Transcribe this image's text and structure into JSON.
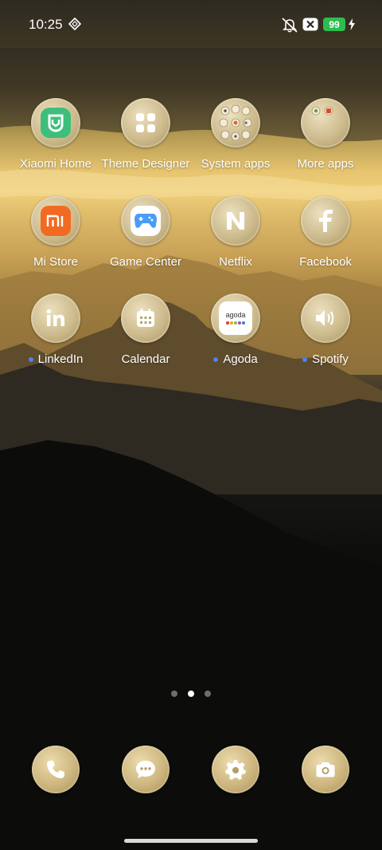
{
  "status_bar": {
    "time": "10:25",
    "battery_level": "99",
    "icons": [
      "vpn-diamond-icon",
      "mute-notifications-icon",
      "close-box-icon",
      "battery-icon",
      "charging-bolt-icon"
    ]
  },
  "apps": [
    {
      "label": "Xiaomi Home",
      "icon": "xiaomi-home-icon",
      "new_dot": false
    },
    {
      "label": "Theme Designer",
      "icon": "theme-designer-icon",
      "new_dot": false
    },
    {
      "label": "System apps",
      "icon": "system-apps-folder-icon",
      "new_dot": false
    },
    {
      "label": "More apps",
      "icon": "more-apps-folder-icon",
      "new_dot": false
    },
    {
      "label": "Mi Store",
      "icon": "mi-store-icon",
      "new_dot": false
    },
    {
      "label": "Game Center",
      "icon": "game-center-icon",
      "new_dot": false
    },
    {
      "label": "Netflix",
      "icon": "netflix-icon",
      "new_dot": false
    },
    {
      "label": "Facebook",
      "icon": "facebook-icon",
      "new_dot": false
    },
    {
      "label": "LinkedIn",
      "icon": "linkedin-icon",
      "new_dot": true
    },
    {
      "label": "Calendar",
      "icon": "calendar-icon",
      "new_dot": false
    },
    {
      "label": "Agoda",
      "icon": "agoda-icon",
      "new_dot": true,
      "logo_text": "agoda"
    },
    {
      "label": "Spotify",
      "icon": "spotify-icon",
      "new_dot": true
    }
  ],
  "pager": {
    "pages": 3,
    "active_page": 2
  },
  "dock": [
    "phone-icon",
    "messages-icon",
    "settings-icon",
    "camera-icon"
  ],
  "colors": {
    "new_dot": "#4c82f0",
    "battery": "#2dbd4e",
    "xiaomi_home": "#3cbf7a",
    "mi_store": "#f26a22",
    "game_center": "#4a9df5"
  }
}
